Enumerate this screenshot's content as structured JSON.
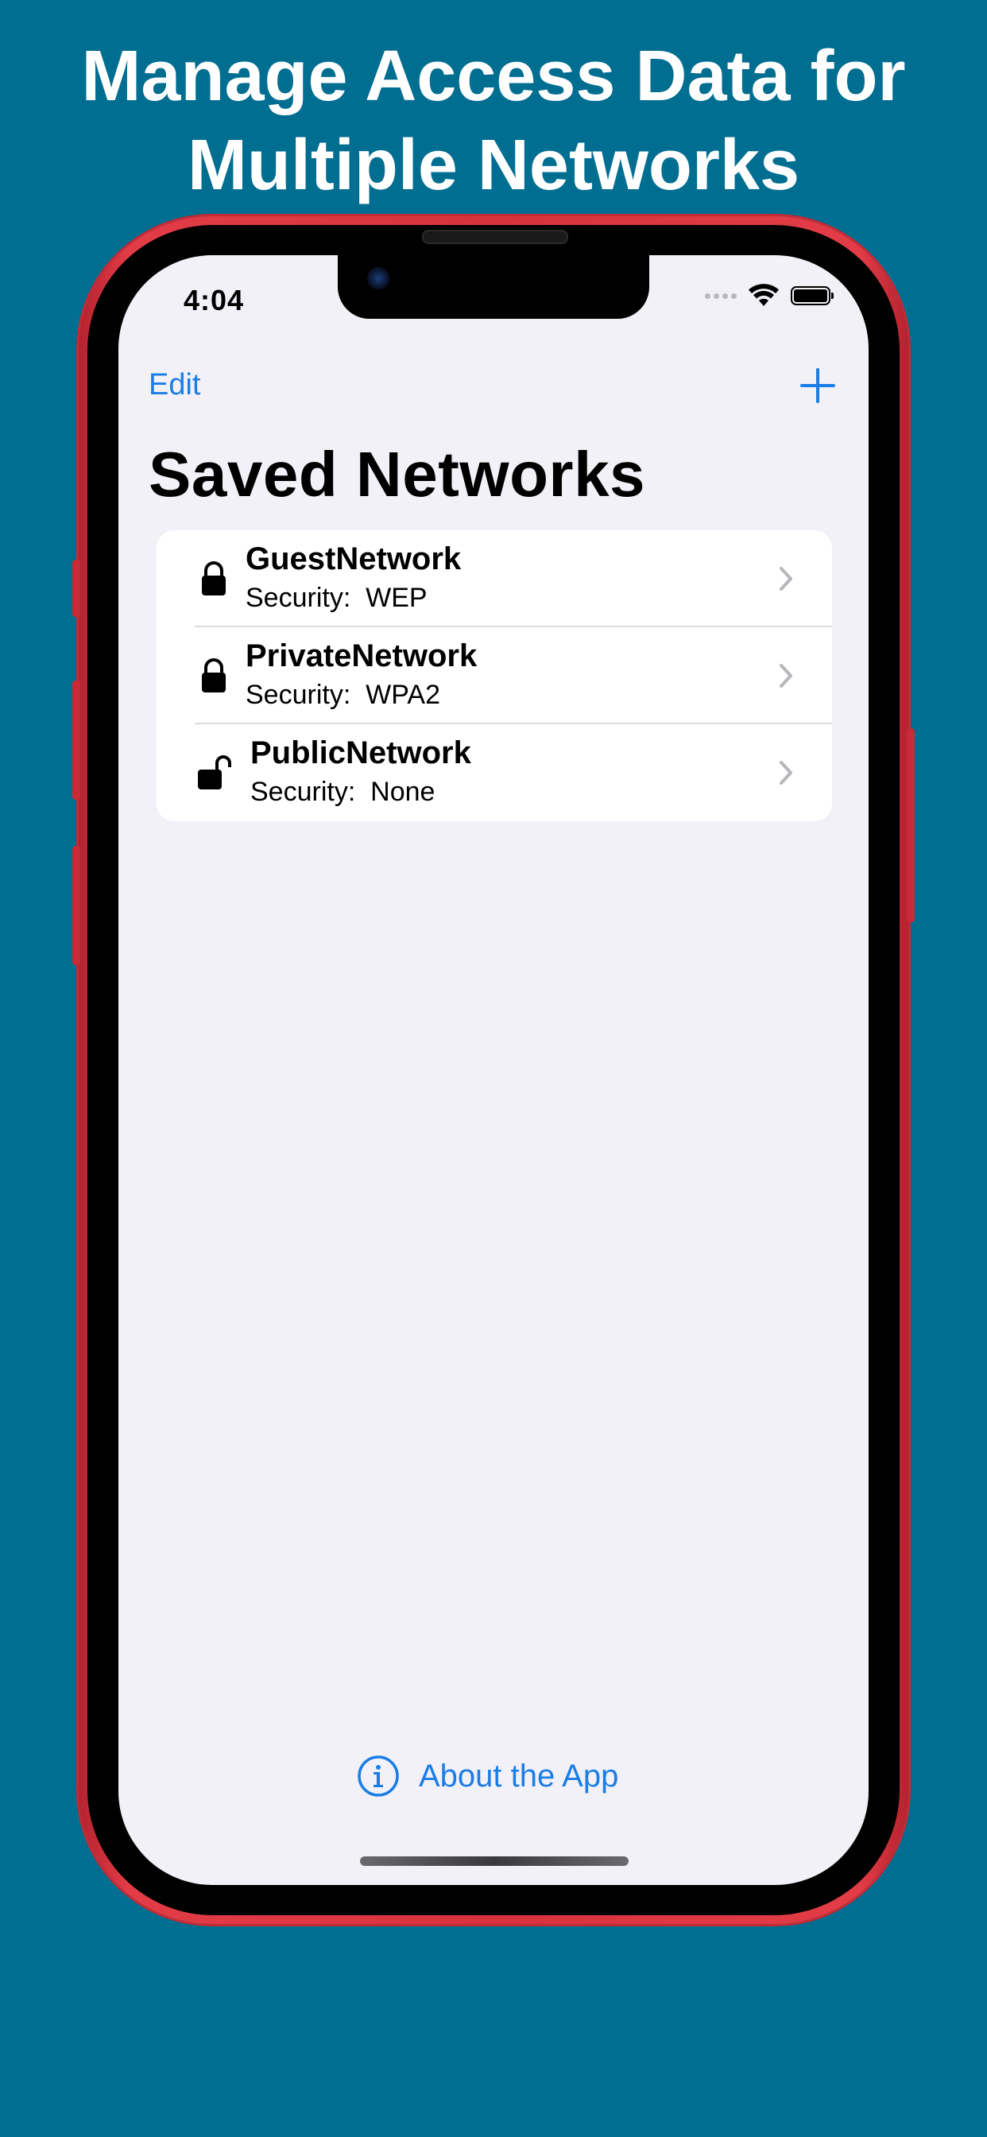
{
  "headline": {
    "line1": "Manage Access Data for",
    "line2": "Multiple Networks"
  },
  "status_bar": {
    "time": "4:04",
    "icons": [
      "signal-dots-icon",
      "wifi-icon",
      "battery-icon"
    ]
  },
  "nav": {
    "edit_label": "Edit",
    "add_icon": "plus-icon"
  },
  "page_title": "Saved Networks",
  "networks": [
    {
      "name": "GuestNetwork",
      "security": "Security:  WEP",
      "icon": "lock-closed-icon"
    },
    {
      "name": "PrivateNetwork",
      "security": "Security:  WPA2",
      "icon": "lock-closed-icon"
    },
    {
      "name": "PublicNetwork",
      "security": "Security:  None",
      "icon": "lock-open-icon"
    }
  ],
  "footer": {
    "about_label": "About the App",
    "about_icon": "info-circle-icon"
  },
  "colors": {
    "background": "#006e91",
    "accent": "#1a7ee6",
    "phone_frame": "#d8323d",
    "screen_bg": "#f2f1f7"
  }
}
